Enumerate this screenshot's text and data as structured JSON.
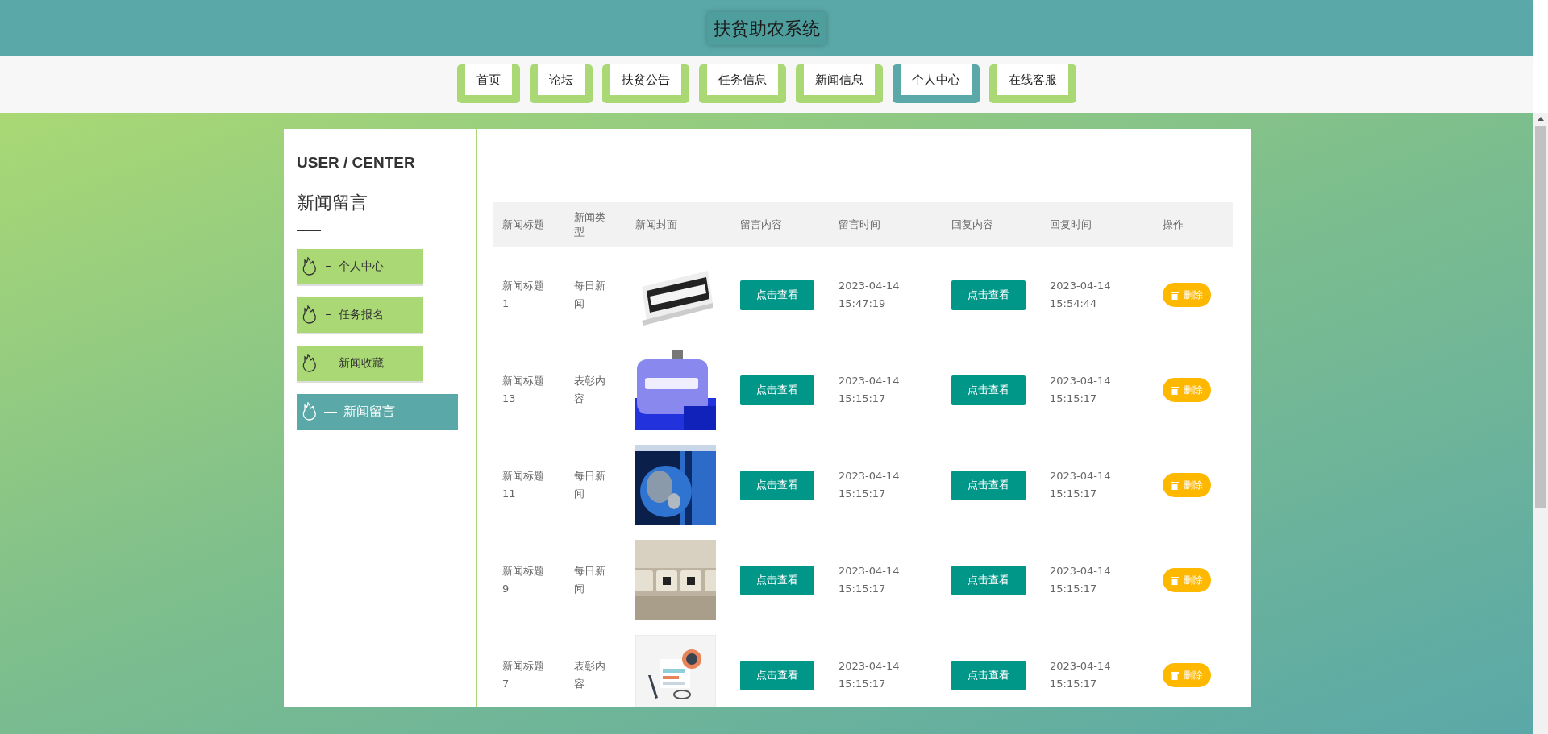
{
  "header": {
    "title": "扶贫助农系统"
  },
  "nav": [
    {
      "label": "首页",
      "selected": false
    },
    {
      "label": "论坛",
      "selected": false
    },
    {
      "label": "扶贫公告",
      "selected": false
    },
    {
      "label": "任务信息",
      "selected": false
    },
    {
      "label": "新闻信息",
      "selected": false
    },
    {
      "label": "个人中心",
      "selected": true
    },
    {
      "label": "在线客服",
      "selected": false
    }
  ],
  "sidebar": {
    "heading": "USER / CENTER",
    "subtitle": "新闻留言",
    "items": [
      {
        "label": "个人中心",
        "selected": false
      },
      {
        "label": "任务报名",
        "selected": false
      },
      {
        "label": "新闻收藏",
        "selected": false
      },
      {
        "label": "新闻留言",
        "selected": true
      }
    ]
  },
  "table": {
    "columns": [
      "新闻标题",
      "新闻类型",
      "新闻封面",
      "留言内容",
      "留言时间",
      "回复内容",
      "回复时间",
      "操作"
    ],
    "rows": [
      {
        "title": "新闻标题1",
        "type": "每日新闻",
        "message": "点击查看",
        "message_time": "2023-04-14 15:47:19",
        "reply": "点击查看",
        "reply_time": "2023-04-14 15:54:44",
        "action": "删除"
      },
      {
        "title": "新闻标题13",
        "type": "表彰内容",
        "message": "点击查看",
        "message_time": "2023-04-14 15:15:17",
        "reply": "点击查看",
        "reply_time": "2023-04-14 15:15:17",
        "action": "删除"
      },
      {
        "title": "新闻标题11",
        "type": "每日新闻",
        "message": "点击查看",
        "message_time": "2023-04-14 15:15:17",
        "reply": "点击查看",
        "reply_time": "2023-04-14 15:15:17",
        "action": "删除"
      },
      {
        "title": "新闻标题9",
        "type": "每日新闻",
        "message": "点击查看",
        "message_time": "2023-04-14 15:15:17",
        "reply": "点击查看",
        "reply_time": "2023-04-14 15:15:17",
        "action": "删除"
      },
      {
        "title": "新闻标题7",
        "type": "表彰内容",
        "message": "点击查看",
        "message_time": "2023-04-14 15:15:17",
        "reply": "点击查看",
        "reply_time": "2023-04-14 15:15:17",
        "action": "删除"
      }
    ]
  }
}
